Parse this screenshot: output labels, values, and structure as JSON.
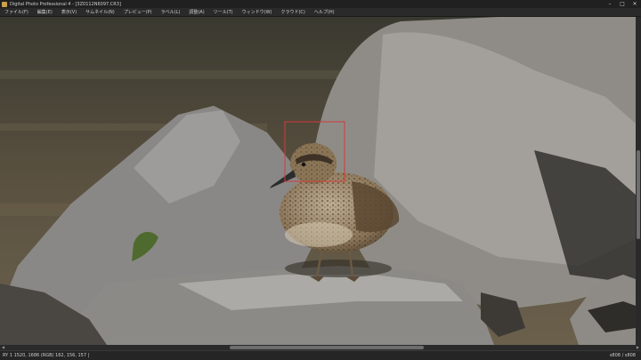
{
  "window": {
    "title": "Digital Photo Professional 4 - [3Z0112N6097.CR3]",
    "controls": [
      "–",
      "□",
      "✕"
    ]
  },
  "menu": [
    "ファイル(F)",
    "編集(E)",
    "表示(V)",
    "サムネイル(N)",
    "プレビュー(P)",
    "ラベル(L)",
    "調整(A)",
    "ツール(T)",
    "ウィンドウ(W)",
    "クラウド(C)",
    "ヘルプ(H)"
  ],
  "viewer": {
    "subject": "duck on rocks",
    "af_frame_color": "#d23a3a"
  },
  "status": {
    "rgb_readout": "RY 1 1520, 1686 (RGB) 162, 156, 157 |",
    "page_counter": "s808 / s808"
  }
}
